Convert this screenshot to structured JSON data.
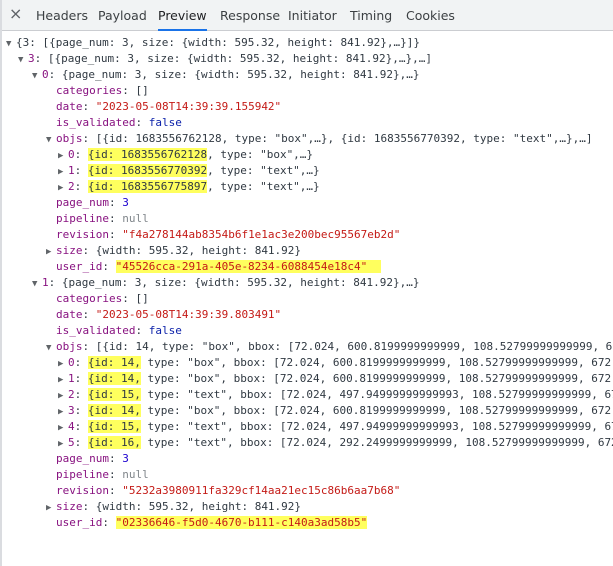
{
  "tabs": [
    {
      "label": "Headers"
    },
    {
      "label": "Payload"
    },
    {
      "label": "Preview"
    },
    {
      "label": "Response"
    },
    {
      "label": "Initiator"
    },
    {
      "label": "Timing"
    },
    {
      "label": "Cookies"
    }
  ],
  "close_label": "×",
  "active_tab": "Preview",
  "preview": {
    "root": "{3: [{page_num: 3, size: {width: 595.32, height: 841.92},…}]}",
    "l3_key": "3",
    "l3_summary": "[{page_num: 3, size: {width: 595.32, height: 841.92},…},…]",
    "items": [
      {
        "index": "0",
        "summary": "{page_num: 3, size: {width: 595.32, height: 841.92},…}",
        "categories": "[]",
        "date": "\"2023-05-08T14:39:39.155942\"",
        "is_validated": "false",
        "objs_summary": "[{id: 1683556762128, type: \"box\",…}, {id: 1683556770392, type: \"text\",…},…]",
        "objs": [
          {
            "index": "0",
            "id": "id: 1683556762128",
            "rest": ", type: \"box\",…}"
          },
          {
            "index": "1",
            "id": "id: 1683556770392",
            "rest": ", type: \"text\",…}"
          },
          {
            "index": "2",
            "id": "id: 1683556775897",
            "rest": ", type: \"text\",…}"
          }
        ],
        "page_num": "3",
        "pipeline": "null",
        "revision": "\"f4a278144ab8354b6f1e1ac3e200bec95567eb2d\"",
        "size": "{width: 595.32, height: 841.92}",
        "user_id": "\"45526cca-291a-405e-8234-6088454e18c4\""
      },
      {
        "index": "1",
        "summary": "{page_num: 3, size: {width: 595.32, height: 841.92},…}",
        "categories": "[]",
        "date": "\"2023-05-08T14:39:39.803491\"",
        "is_validated": "false",
        "objs_summary": "[{id: 14, type: \"box\", bbox: [72.024, 600.8199999999999, 108.52799999999999, 67",
        "objs": [
          {
            "index": "0",
            "id": "{id: 14,",
            "rest": " type: \"box\", bbox: [72.024, 600.8199999999999, 108.52799999999999, 672."
          },
          {
            "index": "1",
            "id": "{id: 14,",
            "rest": " type: \"box\", bbox: [72.024, 600.8199999999999, 108.52799999999999, 672."
          },
          {
            "index": "2",
            "id": "{id: 15,",
            "rest": " type: \"text\", bbox: [72.024, 497.94999999999993, 108.52799999999999, 67"
          },
          {
            "index": "3",
            "id": "{id: 14,",
            "rest": " type: \"box\", bbox: [72.024, 600.8199999999999, 108.52799999999999, 672."
          },
          {
            "index": "4",
            "id": "{id: 15,",
            "rest": " type: \"text\", bbox: [72.024, 497.94999999999993, 108.52799999999999, 67"
          },
          {
            "index": "5",
            "id": "{id: 16,",
            "rest": " type: \"text\", bbox: [72.024, 292.2499999999999, 108.52799999999999, 672"
          }
        ],
        "page_num": "3",
        "pipeline": "null",
        "revision": "\"5232a3980911fa329cf14aa21ec15c86b6aa7b68\"",
        "size": "{width: 595.32, height: 841.92}",
        "user_id": "\"02336646-f5d0-4670-b111-c140a3ad58b5\""
      }
    ]
  }
}
